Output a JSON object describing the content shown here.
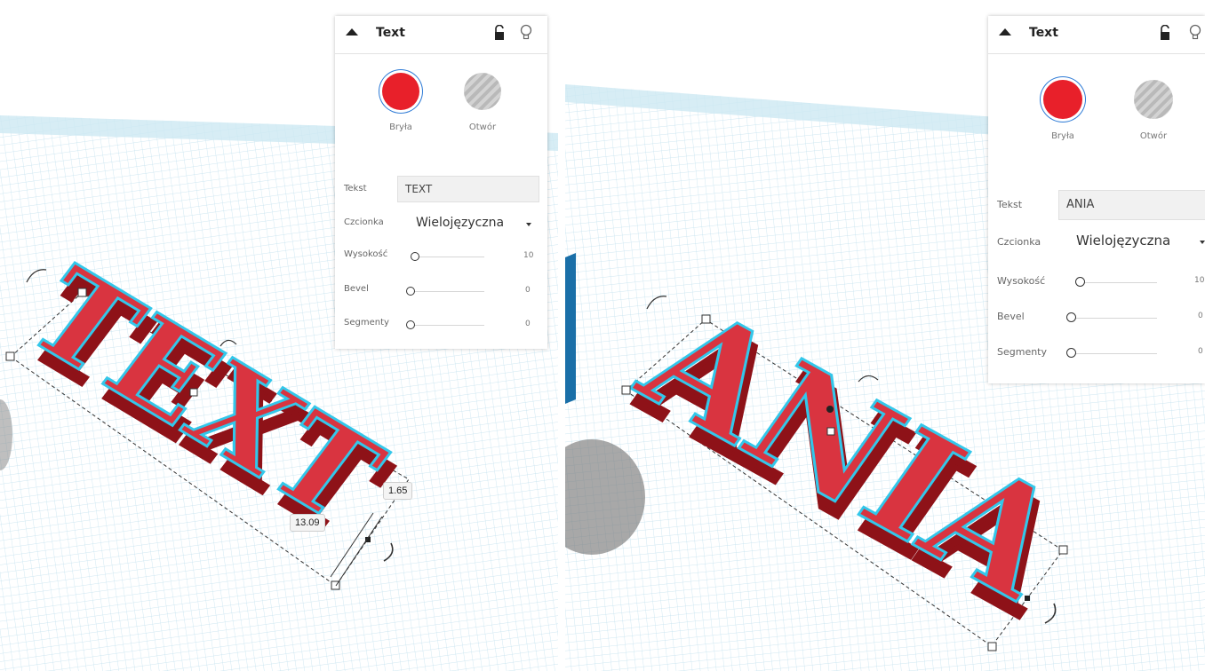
{
  "panels": [
    {
      "title": "Text",
      "solid_label": "Bryła",
      "hole_label": "Otwór",
      "props": {
        "text_label": "Tekst",
        "text_value": "TEXT",
        "font_label": "Czcionka",
        "font_value": "Wielojęzyczna",
        "height_label": "Wysokość",
        "height_value": "10",
        "bevel_label": "Bevel",
        "bevel_value": "0",
        "segments_label": "Segmenty",
        "segments_value": "0"
      }
    },
    {
      "title": "Text",
      "solid_label": "Bryła",
      "hole_label": "Otwór",
      "props": {
        "text_label": "Tekst",
        "text_value": "ANIA",
        "font_label": "Czcionka",
        "font_value": "Wielojęzyczna",
        "height_label": "Wysokość",
        "height_value": "10",
        "bevel_label": "Bevel",
        "bevel_value": "0",
        "segments_label": "Segmenty",
        "segments_value": "0"
      }
    }
  ],
  "scene_left": {
    "object_text": "TEXT",
    "dim_width": "13.09",
    "dim_depth": "1.65"
  },
  "scene_right": {
    "object_text": "ANIA"
  },
  "colors": {
    "solid": "#e8202a",
    "selection_outline": "#33c7ea",
    "workplane": "#dff0f8"
  }
}
